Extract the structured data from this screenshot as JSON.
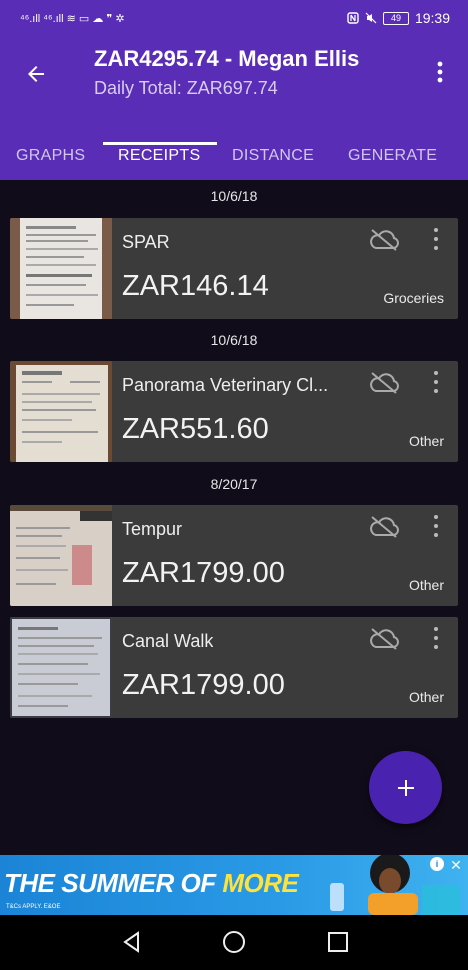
{
  "status_bar": {
    "left_text": "⁴⁶.ıll ⁴⁶.ıll ≋ ▭ ☁ ❞ ✲",
    "battery": "49",
    "time": "19:39"
  },
  "app_bar": {
    "title": "ZAR4295.74 - Megan Ellis",
    "subtitle": "Daily Total: ZAR697.74"
  },
  "tabs": [
    {
      "label": "GRAPHS",
      "active": false
    },
    {
      "label": "RECEIPTS",
      "active": true
    },
    {
      "label": "DISTANCE",
      "active": false
    },
    {
      "label": "GENERATE",
      "active": false
    }
  ],
  "receipts": [
    {
      "date": "10/6/18",
      "name": "SPAR",
      "amount": "ZAR146.14",
      "category": "Groceries"
    },
    {
      "date": "10/6/18",
      "name": "Panorama Veterinary Cl...",
      "amount": "ZAR551.60",
      "category": "Other"
    },
    {
      "date": "8/20/17",
      "name": "Tempur",
      "amount": "ZAR1799.00",
      "category": "Other"
    },
    {
      "date": "",
      "name": "Canal Walk",
      "amount": "ZAR1799.00",
      "category": "Other"
    }
  ],
  "fab": {
    "label": "+"
  },
  "ad": {
    "headline_part1": "THE SUMMER OF ",
    "headline_part2": "MORE",
    "fine_print": "T&Cs APPLY. E&OE",
    "info": "i",
    "close": "✕"
  },
  "colors": {
    "primary": "#5a2db6",
    "background": "#110c1a",
    "card": "#3b3b3b",
    "fab": "#4a22b0",
    "ad_highlight": "#ffe23a"
  },
  "icons": [
    "back-arrow-icon",
    "more-vert-icon",
    "cloud-off-icon",
    "plus-icon",
    "nav-back-icon",
    "nav-home-icon",
    "nav-recents-icon"
  ]
}
